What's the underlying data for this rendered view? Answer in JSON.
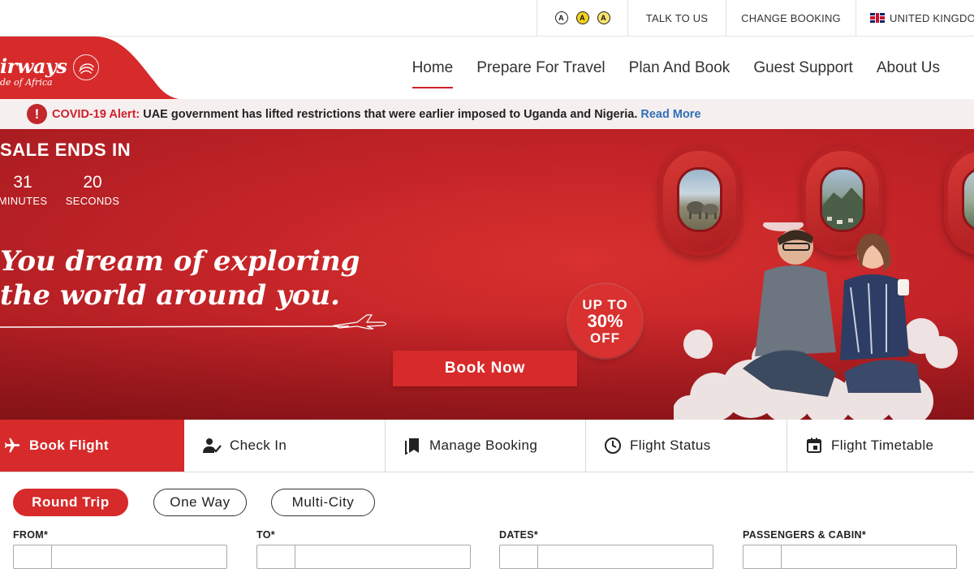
{
  "topbar": {
    "accessibility": [
      {
        "label": "A",
        "name": "contrast-normal-icon"
      },
      {
        "label": "A",
        "name": "contrast-yellow-icon"
      },
      {
        "label": "A",
        "name": "contrast-highlight-icon"
      }
    ],
    "talk_to_us": "TALK TO US",
    "change_booking": "CHANGE BOOKING",
    "language": "UNITED KINGDOM"
  },
  "header": {
    "logo_text": "irways",
    "logo_sub": "de of Africa",
    "nav": [
      "Home",
      "Prepare For Travel",
      "Plan And Book",
      "Guest Support",
      "About Us"
    ],
    "active_nav": "Home"
  },
  "alert": {
    "icon": "!",
    "title": "COVID-19 Alert:",
    "message": "UAE government has lifted restrictions that were earlier imposed to Uganda and Nigeria.",
    "link": "Read More"
  },
  "hero": {
    "sale_title": "SALE ENDS IN",
    "countdown": {
      "minutes_value": "31",
      "minutes_label": "MINUTES",
      "seconds_value": "20",
      "seconds_label": "SECONDS"
    },
    "tagline_line1": "You dream of exploring",
    "tagline_line2": "the world around you.",
    "cta": "Book Now",
    "promo_line1": "UP TO",
    "promo_line2": "30%",
    "promo_line3": "OFF"
  },
  "booking_tabs": [
    {
      "label": "Book Flight",
      "icon": "airplane-icon",
      "active": true
    },
    {
      "label": "Check In",
      "icon": "check-in-person-icon",
      "active": false
    },
    {
      "label": "Manage Booking",
      "icon": "bookmark-icon",
      "active": false
    },
    {
      "label": "Flight Status",
      "icon": "clock-icon",
      "active": false
    },
    {
      "label": "Flight Timetable",
      "icon": "calendar-icon",
      "active": false
    }
  ],
  "trip_types": {
    "round": "Round Trip",
    "one": "One Way",
    "multi": "Multi-City",
    "selected": "Round Trip"
  },
  "form": {
    "from_label": "FROM*",
    "to_label": "TO*",
    "dates_label": "DATES*",
    "passengers_label": "PASSENGERS & CABIN*"
  },
  "colors": {
    "brand_red": "#d72a2b",
    "alert_bg": "#f6efef",
    "link_blue": "#2f6fb8"
  }
}
